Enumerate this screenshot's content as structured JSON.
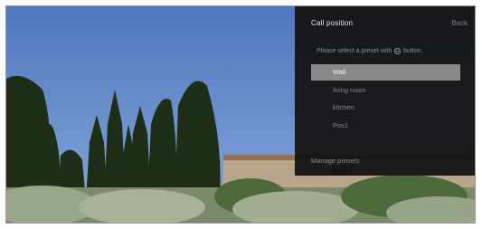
{
  "panel": {
    "title": "Call position",
    "back_label": "Back",
    "instruction_before": "Please select a preset with",
    "instruction_icon": "ok-button-icon",
    "instruction_after": "button.",
    "presets": [
      {
        "label": "Wall",
        "selected": true
      },
      {
        "label": "living room",
        "selected": false
      },
      {
        "label": "kitchen",
        "selected": false
      },
      {
        "label": "Pos1",
        "selected": false
      }
    ],
    "manage_label": "Manage presets"
  },
  "colors": {
    "panel_bg": "#141414",
    "selected_bg": "#8a8a8a",
    "sky": "#5f86c6"
  }
}
